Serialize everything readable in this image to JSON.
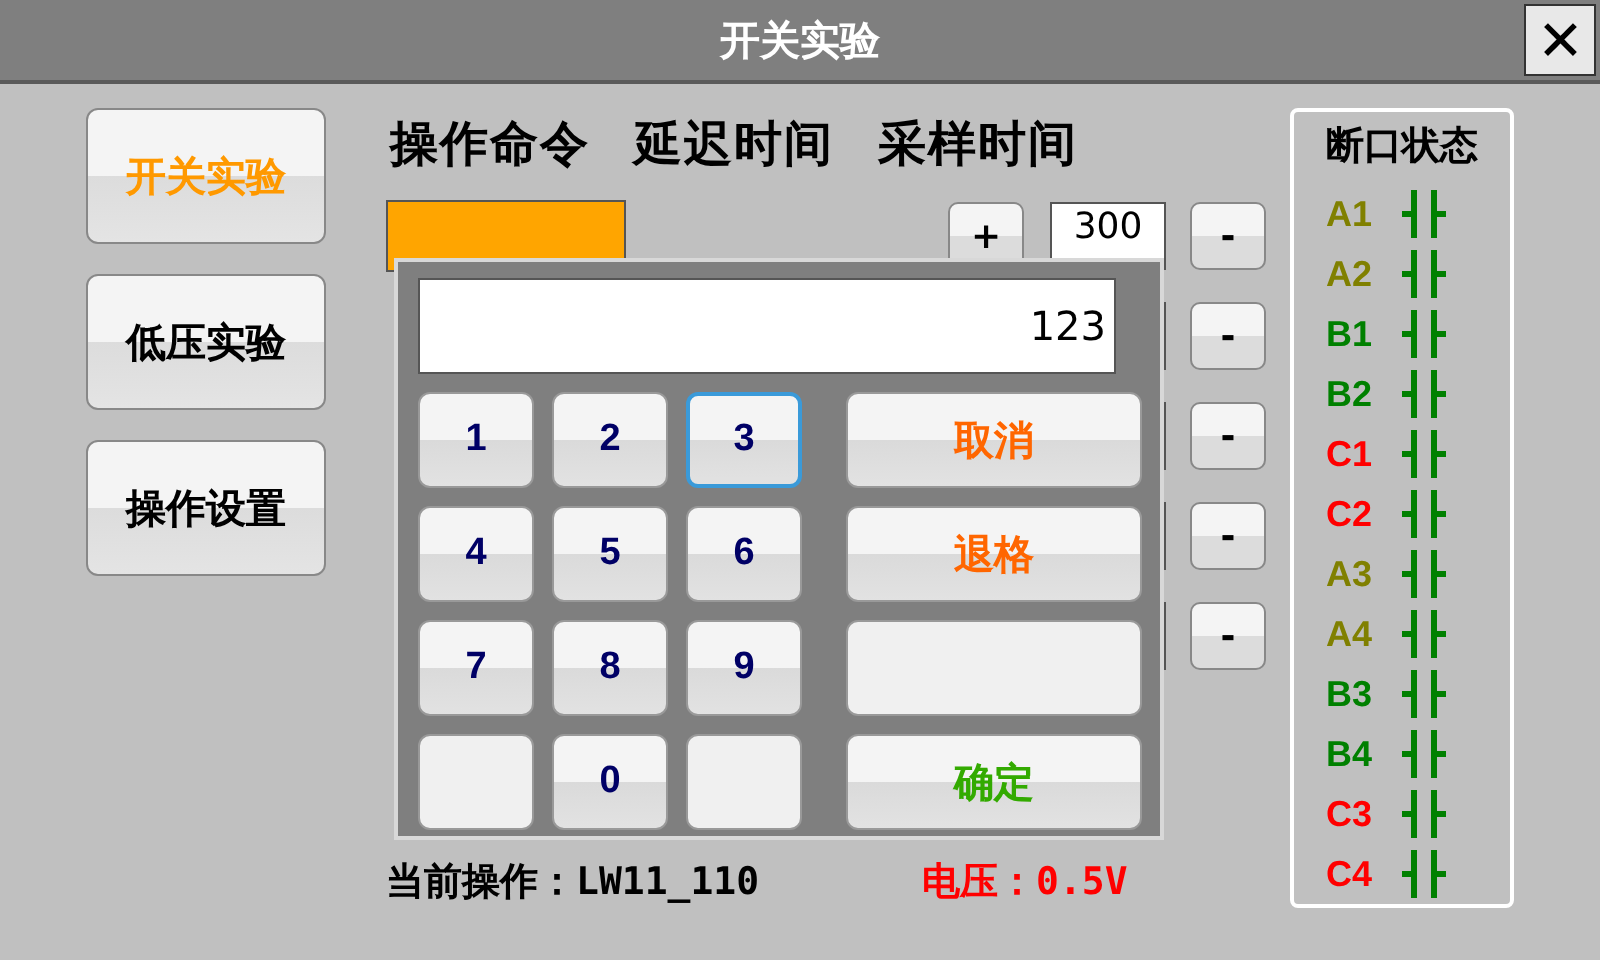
{
  "window": {
    "title": "开关实验",
    "close": "✕"
  },
  "nav": [
    {
      "label": "开关实验",
      "selected": true
    },
    {
      "label": "低压实验",
      "selected": false
    },
    {
      "label": "操作设置",
      "selected": false
    }
  ],
  "headers": [
    "操作命令",
    "延迟时间",
    "采样时间"
  ],
  "rows": [
    {
      "kind": "full",
      "plus": "+",
      "value": "300",
      "minus": "-"
    },
    {
      "kind": "minus_only",
      "minus": "-"
    },
    {
      "kind": "minus_only",
      "minus": "-"
    },
    {
      "kind": "minus_only",
      "minus": "-"
    },
    {
      "kind": "minus_only",
      "minus": "-"
    }
  ],
  "status": {
    "operation": "当前操作：LW11_110",
    "voltage": "电压：0.5V"
  },
  "breakers": {
    "title": "断口状态",
    "items": [
      {
        "label": "A1",
        "color": "#808000"
      },
      {
        "label": "A2",
        "color": "#808000"
      },
      {
        "label": "B1",
        "color": "#008000"
      },
      {
        "label": "B2",
        "color": "#008000"
      },
      {
        "label": "C1",
        "color": "#ff0000"
      },
      {
        "label": "C2",
        "color": "#ff0000"
      },
      {
        "label": "A3",
        "color": "#808000"
      },
      {
        "label": "A4",
        "color": "#808000"
      },
      {
        "label": "B3",
        "color": "#008000"
      },
      {
        "label": "B4",
        "color": "#008000"
      },
      {
        "label": "C3",
        "color": "#ff0000"
      },
      {
        "label": "C4",
        "color": "#ff0000"
      }
    ]
  },
  "keypad": {
    "display": "123",
    "keys": [
      {
        "kind": "digit",
        "label": "1",
        "selected": false
      },
      {
        "kind": "digit",
        "label": "2",
        "selected": false
      },
      {
        "kind": "digit",
        "label": "3",
        "selected": true
      },
      {
        "kind": "digit",
        "label": "4",
        "selected": false
      },
      {
        "kind": "digit",
        "label": "5",
        "selected": false
      },
      {
        "kind": "digit",
        "label": "6",
        "selected": false
      },
      {
        "kind": "digit",
        "label": "7",
        "selected": false
      },
      {
        "kind": "digit",
        "label": "8",
        "selected": false
      },
      {
        "kind": "digit",
        "label": "9",
        "selected": false
      },
      {
        "kind": "blank",
        "selected": false
      },
      {
        "kind": "digit",
        "label": "0",
        "selected": false
      },
      {
        "kind": "blank",
        "selected": false
      }
    ],
    "actions": [
      {
        "kind": "action",
        "label": "取消",
        "color": "#ff6600"
      },
      {
        "kind": "action",
        "label": "退格",
        "color": "#ff6600"
      },
      {
        "kind": "blank"
      },
      {
        "kind": "action",
        "label": "确定",
        "color": "#33aa00"
      }
    ]
  }
}
